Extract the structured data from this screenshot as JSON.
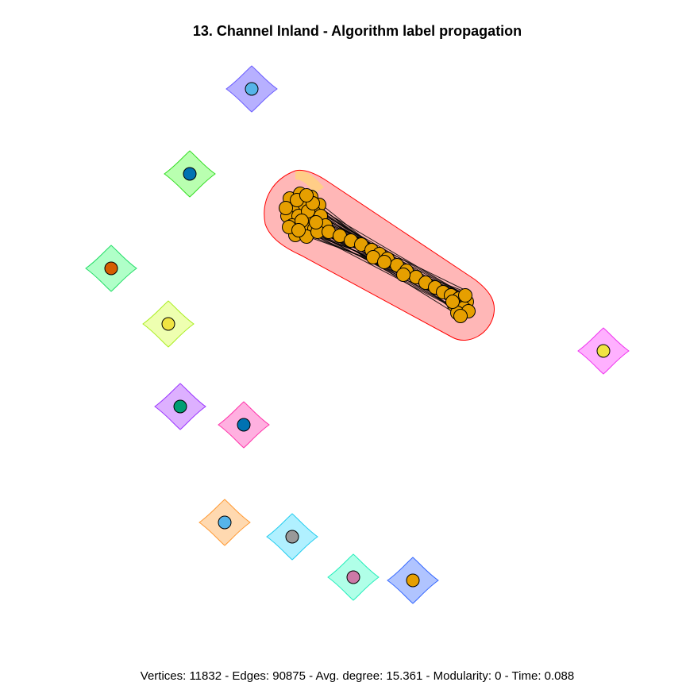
{
  "title": "13. Channel Inland - Algorithm label propagation",
  "footer": "Vertices: 11832 - Edges: 90875 - Avg. degree: 15.361 - Modularity: 0 - Time: 0.088",
  "main_cluster": {
    "fill": "#ffb3b3",
    "stroke": "#ff0000",
    "node_color": "#e69f00"
  },
  "singletons": [
    {
      "fill": "#b7b0ff",
      "stroke": "#6a5cff",
      "node": "#56b4e9"
    },
    {
      "fill": "#b9ffb0",
      "stroke": "#33dd22",
      "node": "#0072b2"
    },
    {
      "fill": "#b0ffc8",
      "stroke": "#22dd66",
      "node": "#d55e00"
    },
    {
      "fill": "#eeffb0",
      "stroke": "#aaee22",
      "node": "#f0e442"
    },
    {
      "fill": "#ddb0ff",
      "stroke": "#9933ff",
      "node": "#009e73"
    },
    {
      "fill": "#ffb0e0",
      "stroke": "#ff33aa",
      "node": "#0072b2"
    },
    {
      "fill": "#ffd9b0",
      "stroke": "#ff9933",
      "node": "#56b4e9"
    },
    {
      "fill": "#b0f0ff",
      "stroke": "#22ccee",
      "node": "#999999"
    },
    {
      "fill": "#b0ffe8",
      "stroke": "#22eebb",
      "node": "#cc79a7"
    },
    {
      "fill": "#b0c4ff",
      "stroke": "#3366ff",
      "node": "#e69f00"
    },
    {
      "fill": "#ffb0ff",
      "stroke": "#ee33ee",
      "node": "#f0e442"
    }
  ]
}
